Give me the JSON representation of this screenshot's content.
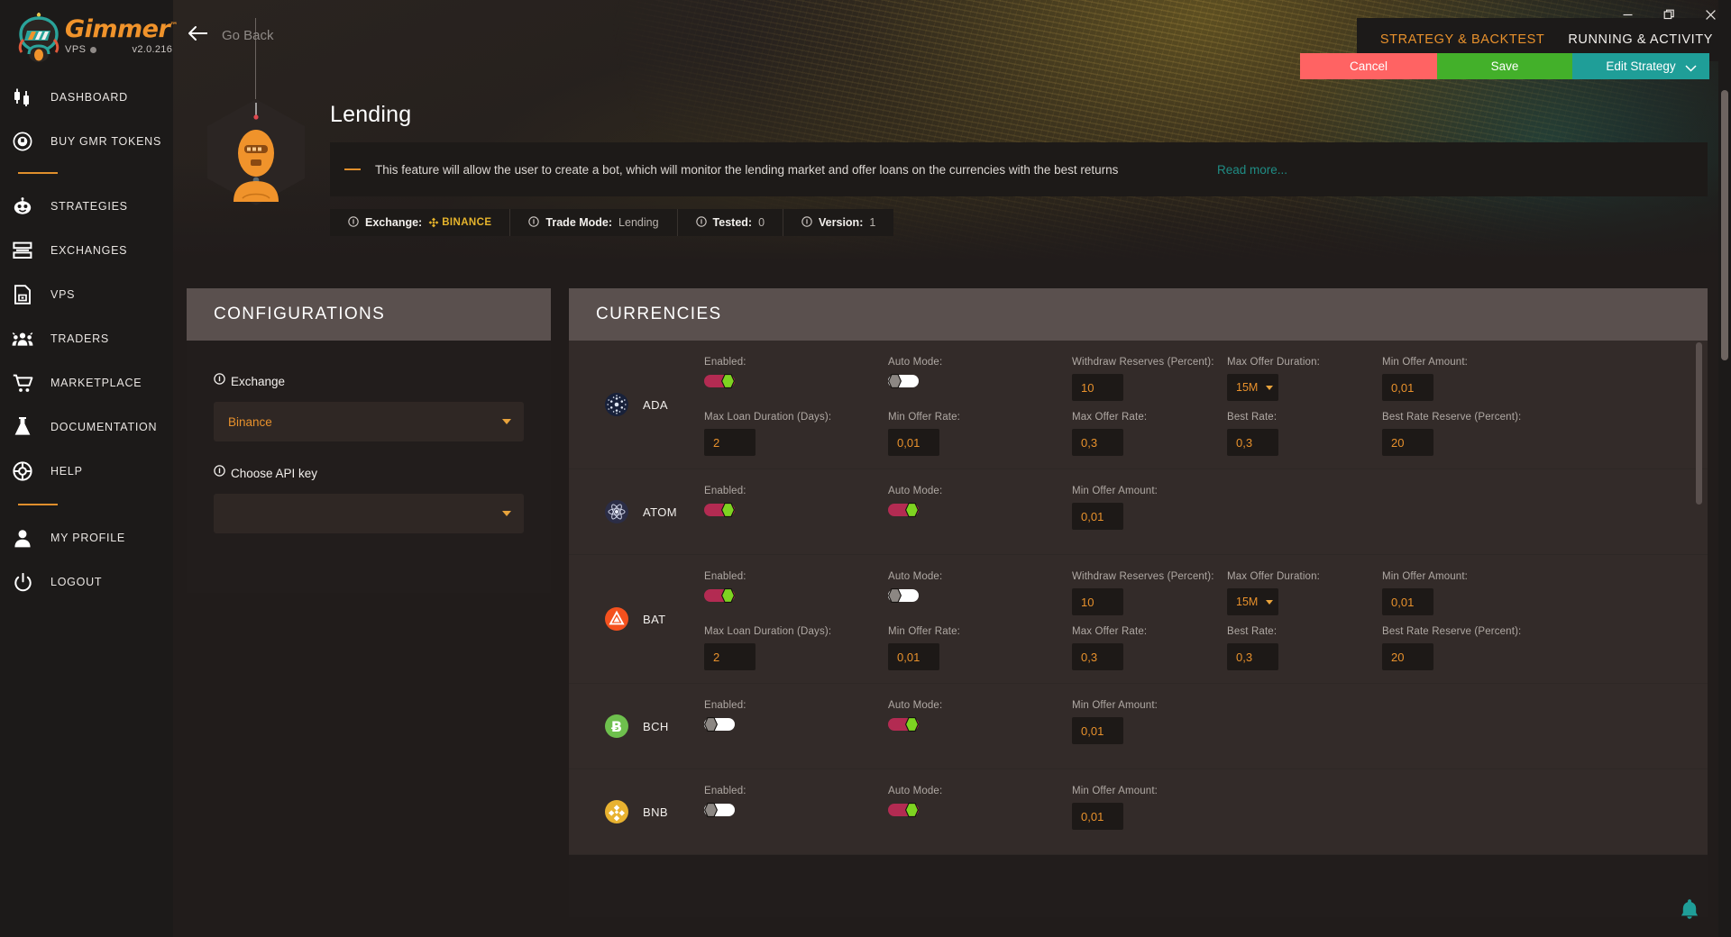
{
  "brand": {
    "name": "Gimmer",
    "tm": "™",
    "vps_label": "VPS",
    "version": "v2.0.216"
  },
  "window_controls": {
    "minimize": "minimize-icon",
    "maximize": "restore-icon",
    "close": "close-icon"
  },
  "sidebar": {
    "items": [
      {
        "label": "DASHBOARD",
        "icon": "candlestick-icon"
      },
      {
        "label": "BUY GMR TOKENS",
        "icon": "token-coin-icon"
      },
      {
        "label": "STRATEGIES",
        "icon": "robot-icon"
      },
      {
        "label": "EXCHANGES",
        "icon": "exchange-stack-icon"
      },
      {
        "label": "VPS",
        "icon": "server-document-icon"
      },
      {
        "label": "TRADERS",
        "icon": "people-icon"
      },
      {
        "label": "MARKETPLACE",
        "icon": "shopping-cart-icon"
      },
      {
        "label": "DOCUMENTATION",
        "icon": "flask-icon"
      },
      {
        "label": "HELP",
        "icon": "lifebuoy-icon"
      },
      {
        "label": "MY PROFILE",
        "icon": "user-icon"
      },
      {
        "label": "LOGOUT",
        "icon": "power-icon"
      }
    ]
  },
  "header": {
    "go_back": "Go Back",
    "tabs": [
      {
        "label": "STRATEGY & BACKTEST",
        "active": true
      },
      {
        "label": "RUNNING & ACTIVITY",
        "active": false
      }
    ],
    "buttons": {
      "cancel": "Cancel",
      "save": "Save",
      "edit_strategy": "Edit Strategy"
    },
    "colors": {
      "cancel": "#ff6363",
      "save": "#43b02a",
      "edit": "#1f9e98",
      "accent_orange": "#e8912c",
      "teal_link": "#1f8c84"
    }
  },
  "bot": {
    "title": "Lending",
    "description": "This feature will allow the user to create a bot, which will monitor the lending market and offer loans on the currencies with the best returns",
    "read_more": "Read more...",
    "chips": [
      {
        "key": "Exchange:",
        "value": "BINANCE",
        "is_exchange": true
      },
      {
        "key": "Trade Mode:",
        "value": "Lending",
        "is_exchange": false
      },
      {
        "key": "Tested:",
        "value": "0",
        "is_exchange": false
      },
      {
        "key": "Version:",
        "value": "1",
        "is_exchange": false
      }
    ]
  },
  "configurations": {
    "title": "CONFIGURATIONS",
    "exchange": {
      "label": "Exchange",
      "value": "Binance"
    },
    "api_key": {
      "label": "Choose API key",
      "value": ""
    }
  },
  "currencies": {
    "title": "CURRENCIES",
    "labels": {
      "enabled": "Enabled:",
      "auto_mode": "Auto Mode:",
      "withdraw_reserves": "Withdraw Reserves (Percent):",
      "max_offer_duration": "Max Offer Duration:",
      "min_offer_amount": "Min Offer Amount:",
      "max_loan_duration": "Max Loan Duration (Days):",
      "min_offer_rate": "Min Offer Rate:",
      "max_offer_rate": "Max Offer Rate:",
      "best_rate": "Best Rate:",
      "best_rate_reserve": "Best Rate Reserve (Percent):"
    },
    "rows": [
      {
        "symbol": "ADA",
        "icon": "cardano-icon",
        "icon_bg": "#18213a",
        "enabled": true,
        "auto_mode": false,
        "expanded": true,
        "withdraw_reserves": "10",
        "max_offer_duration": "15M",
        "min_offer_amount": "0,01",
        "max_loan_duration": "2",
        "min_offer_rate": "0,01",
        "max_offer_rate": "0,3",
        "best_rate": "0,3",
        "best_rate_reserve": "20"
      },
      {
        "symbol": "ATOM",
        "icon": "cosmos-icon",
        "icon_bg": "#2b2d46",
        "enabled": true,
        "auto_mode": true,
        "expanded": false,
        "min_offer_amount": "0,01"
      },
      {
        "symbol": "BAT",
        "icon": "bat-icon",
        "icon_bg": "#f4511e",
        "enabled": true,
        "auto_mode": false,
        "expanded": true,
        "withdraw_reserves": "10",
        "max_offer_duration": "15M",
        "min_offer_amount": "0,01",
        "max_loan_duration": "2",
        "min_offer_rate": "0,01",
        "max_offer_rate": "0,3",
        "best_rate": "0,3",
        "best_rate_reserve": "20"
      },
      {
        "symbol": "BCH",
        "icon": "bitcoin-cash-icon",
        "icon_bg": "#6ec04d",
        "enabled": false,
        "auto_mode": true,
        "expanded": false,
        "min_offer_amount": "0,01"
      },
      {
        "symbol": "BNB",
        "icon": "binance-coin-icon",
        "icon_bg": "#e8b230",
        "enabled": false,
        "auto_mode": true,
        "expanded": false,
        "min_offer_amount": "0,01"
      }
    ]
  },
  "notification": {
    "icon": "bell-icon",
    "color": "#1f9e98"
  }
}
